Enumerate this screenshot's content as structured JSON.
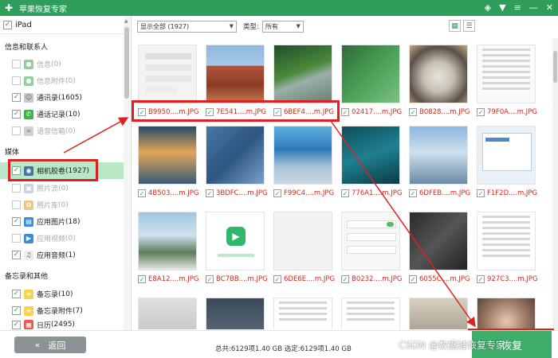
{
  "titlebar": {
    "title": "苹果恢复专家",
    "icons": [
      "diamond-icon",
      "shirt-icon",
      "menu-icon",
      "minimize-icon",
      "close-icon"
    ]
  },
  "sidebar": {
    "device": "iPad",
    "sections": [
      {
        "title": "信息和联系人",
        "items": [
          {
            "label": "信息",
            "count": "(0)",
            "checked": false,
            "enabled": false,
            "icon": "message-icon"
          },
          {
            "label": "信息附件",
            "count": "(0)",
            "checked": false,
            "enabled": false,
            "icon": "message-attachment-icon"
          },
          {
            "label": "通讯录",
            "count": "(1605)",
            "checked": true,
            "enabled": true,
            "icon": "contacts-icon"
          },
          {
            "label": "通话记录",
            "count": "(10)",
            "checked": true,
            "enabled": true,
            "icon": "phone-icon"
          },
          {
            "label": "语音信箱",
            "count": "(0)",
            "checked": false,
            "enabled": false,
            "icon": "voicemail-icon"
          }
        ]
      },
      {
        "title": "媒体",
        "items": [
          {
            "label": "相机胶卷",
            "count": "(1927)",
            "checked": true,
            "enabled": true,
            "icon": "camera-icon",
            "selected": true
          },
          {
            "label": "照片流",
            "count": "(0)",
            "checked": false,
            "enabled": false,
            "icon": "photostream-icon"
          },
          {
            "label": "照片库",
            "count": "(0)",
            "checked": false,
            "enabled": false,
            "icon": "photo-library-icon"
          },
          {
            "label": "应用图片",
            "count": "(18)",
            "checked": true,
            "enabled": true,
            "icon": "app-photo-icon"
          },
          {
            "label": "应用视频",
            "count": "(0)",
            "checked": false,
            "enabled": false,
            "icon": "app-video-icon"
          },
          {
            "label": "应用音频",
            "count": "(1)",
            "checked": true,
            "enabled": true,
            "icon": "music-icon"
          }
        ]
      },
      {
        "title": "备忘录和其他",
        "items": [
          {
            "label": "备忘录",
            "count": "(10)",
            "checked": true,
            "enabled": true,
            "icon": "notes-icon"
          },
          {
            "label": "备忘录附件",
            "count": "(7)",
            "checked": true,
            "enabled": true,
            "icon": "notes-attachment-icon"
          },
          {
            "label": "日历",
            "count": "(2495)",
            "checked": true,
            "enabled": true,
            "icon": "calendar-icon"
          }
        ]
      }
    ]
  },
  "toolbar": {
    "filter_value": "显示全部 (1927)",
    "type_label": "类型:",
    "type_value": "所有"
  },
  "grid": {
    "rows": [
      [
        "B9950....m.JPG",
        "7E541....m.JPG",
        "6BEF4....m.JPG",
        "02417....m.JPG",
        "B0828....m.JPG",
        "79F0A....m.JPG"
      ],
      [
        "4B503....m.JPG",
        "3BDFC....m.JPG",
        "F99C4....m.JPG",
        "776A1....m.JPG",
        "6DFEB....m.JPG",
        "F1F2D....m.JPG"
      ],
      [
        "E8A12....m.JPG",
        "BC7BB....m.JPG",
        "6DE6E....m.JPG",
        "B0232....m.JPG",
        "6055C....m.JPG",
        "927C3....m.JPG"
      ],
      [
        "",
        "",
        "",
        "",
        "",
        ""
      ]
    ]
  },
  "bottom": {
    "back_label": "返回",
    "summary": "总共:6129项1.40 GB 选定:6129项1.40 GB",
    "recover_label": "恢复"
  },
  "watermark": "CSDN @数据蛙恢复专家",
  "colors": {
    "brand": "#2f9e5b",
    "highlight": "#e02020",
    "filename": "#d9251c",
    "selected_row": "#b9e8c7"
  }
}
